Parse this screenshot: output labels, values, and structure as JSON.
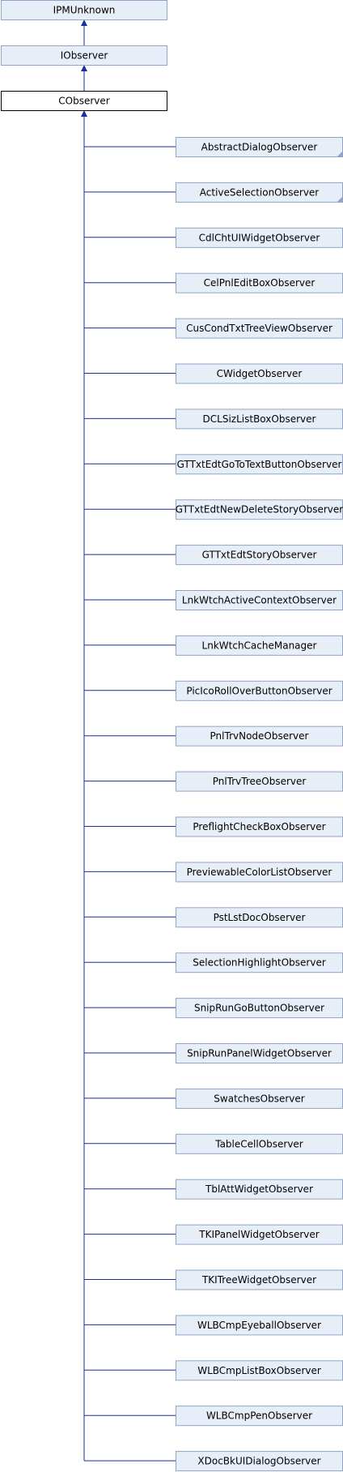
{
  "ancestors": [
    {
      "name": "IPMUnknown",
      "current": false
    },
    {
      "name": "IObserver",
      "current": false
    },
    {
      "name": "CObserver",
      "current": true
    }
  ],
  "children": [
    {
      "name": "AbstractDialogObserver",
      "has_more": true
    },
    {
      "name": "ActiveSelectionObserver",
      "has_more": true
    },
    {
      "name": "CdlChtUIWidgetObserver",
      "has_more": false
    },
    {
      "name": "CelPnlEditBoxObserver",
      "has_more": false
    },
    {
      "name": "CusCondTxtTreeViewObserver",
      "has_more": false
    },
    {
      "name": "CWidgetObserver",
      "has_more": false
    },
    {
      "name": "DCLSizListBoxObserver",
      "has_more": false
    },
    {
      "name": "GTTxtEdtGoToTextButtonObserver",
      "has_more": false
    },
    {
      "name": "GTTxtEdtNewDeleteStoryObserver",
      "has_more": false
    },
    {
      "name": "GTTxtEdtStoryObserver",
      "has_more": false
    },
    {
      "name": "LnkWtchActiveContextObserver",
      "has_more": false
    },
    {
      "name": "LnkWtchCacheManager",
      "has_more": false
    },
    {
      "name": "PicIcoRollOverButtonObserver",
      "has_more": false
    },
    {
      "name": "PnlTrvNodeObserver",
      "has_more": false
    },
    {
      "name": "PnlTrvTreeObserver",
      "has_more": false
    },
    {
      "name": "PreflightCheckBoxObserver",
      "has_more": false
    },
    {
      "name": "PreviewableColorListObserver",
      "has_more": false
    },
    {
      "name": "PstLstDocObserver",
      "has_more": false
    },
    {
      "name": "SelectionHighlightObserver",
      "has_more": false
    },
    {
      "name": "SnipRunGoButtonObserver",
      "has_more": false
    },
    {
      "name": "SnipRunPanelWidgetObserver",
      "has_more": false
    },
    {
      "name": "SwatchesObserver",
      "has_more": false
    },
    {
      "name": "TableCellObserver",
      "has_more": false
    },
    {
      "name": "TblAttWidgetObserver",
      "has_more": false
    },
    {
      "name": "TKIPanelWidgetObserver",
      "has_more": false
    },
    {
      "name": "TKITreeWidgetObserver",
      "has_more": false
    },
    {
      "name": "WLBCmpEyeballObserver",
      "has_more": false
    },
    {
      "name": "WLBCmpListBoxObserver",
      "has_more": false
    },
    {
      "name": "WLBCmpPenObserver",
      "has_more": false
    },
    {
      "name": "XDocBkUIDialogObserver",
      "has_more": false
    }
  ]
}
